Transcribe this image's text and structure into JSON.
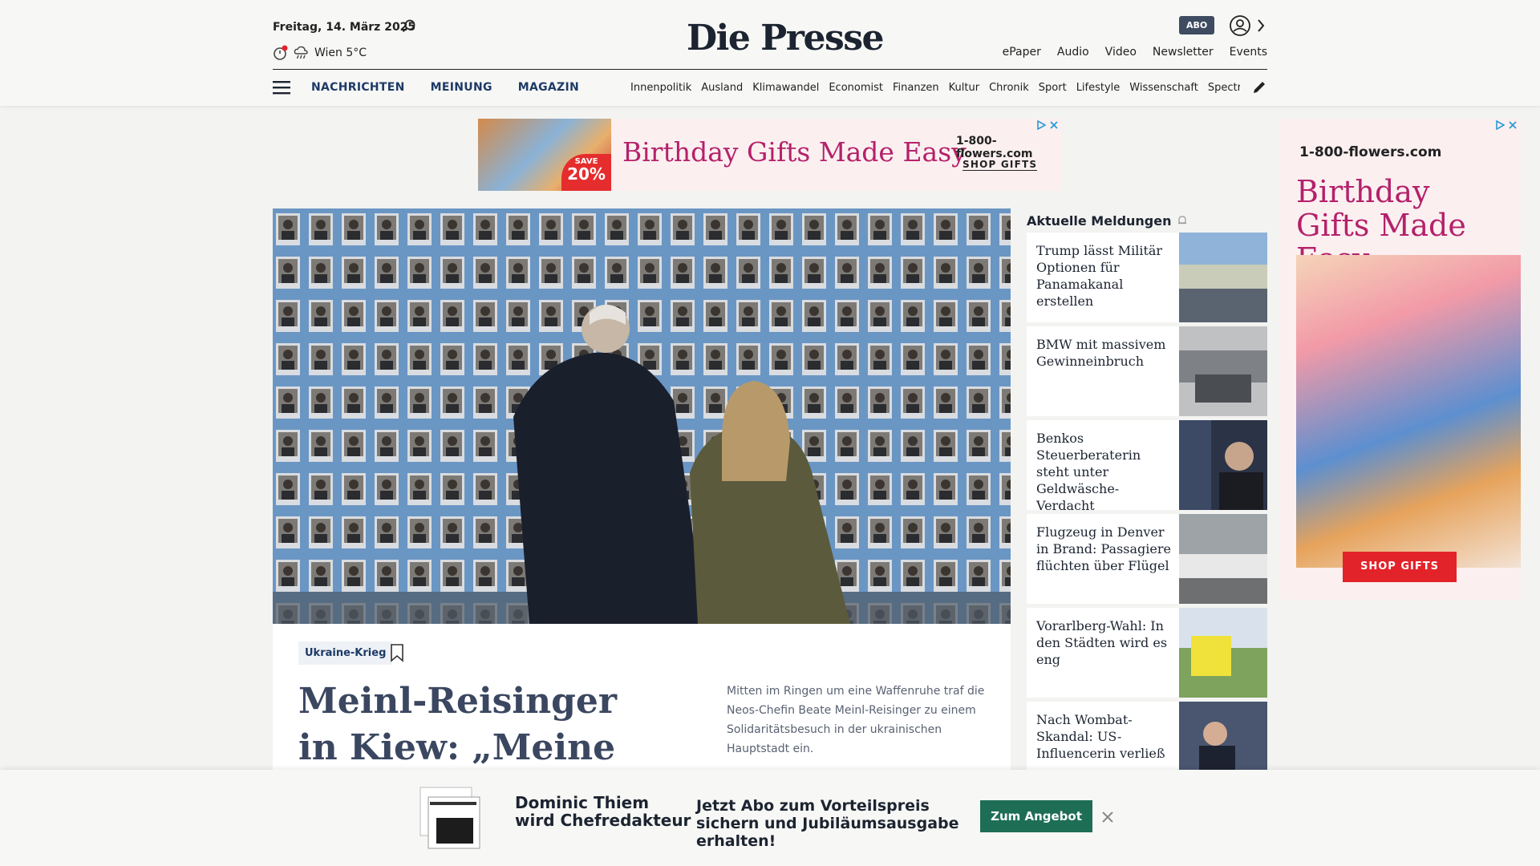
{
  "header": {
    "date": "Freitag, 14. März 2025",
    "weather": "Wien 5°C",
    "logo": "Die Presse",
    "abo_badge": "ABO",
    "top_links": [
      "ePaper",
      "Audio",
      "Video",
      "Newsletter",
      "Events"
    ]
  },
  "nav": {
    "main": [
      "NACHRICHTEN",
      "MEINUNG",
      "MAGAZIN"
    ],
    "sub": [
      "Innenpolitik",
      "Ausland",
      "Klimawandel",
      "Economist",
      "Finanzen",
      "Kultur",
      "Chronik",
      "Sport",
      "Lifestyle",
      "Wissenschaft",
      "Spectrum"
    ]
  },
  "ad_top": {
    "save_label": "SAVE",
    "save_pct": "20%",
    "headline": "Birthday Gifts Made Easy",
    "brand": "1-800-flowers.com",
    "cta": "SHOP GIFTS"
  },
  "hero": {
    "tag": "Ukraine-Krieg",
    "title": "Meinl-Reisinger in Kiew: „Meine erste",
    "teaser": "Mitten im Ringen um eine Waffenruhe traf die Neos-Chefin Beate Meinl-Reisinger zu einem Solidaritätsbesuch in der ukrainischen Hauptstadt ein."
  },
  "news": {
    "title": "Aktuelle Meldungen",
    "items": [
      {
        "text": "Trump lässt Militär Optionen für Panamakanal erstellen"
      },
      {
        "text": "BMW mit massivem Gewinneinbruch"
      },
      {
        "text": "Benkos Steuerberaterin steht unter Geldwäsche-Verdacht"
      },
      {
        "text": "Flugzeug in Denver in Brand: Passagiere flüchten über Flügel"
      },
      {
        "text": "Vorarlberg-Wahl: In den Städten wird es eng"
      },
      {
        "text": "Nach Wombat-Skandal: US-Influencerin verließ"
      }
    ]
  },
  "ad_side": {
    "brand": "1-800-flowers.com",
    "headline": "Birthday Gifts Made Easy",
    "cta": "SHOP GIFTS"
  },
  "promo": {
    "title": "Dominic Thiem wird Chefredakteur",
    "text": "Jetzt Abo zum Vorteilspreis sichern und Jubiläumsausgabe erhalten!",
    "button": "Zum Angebot"
  }
}
